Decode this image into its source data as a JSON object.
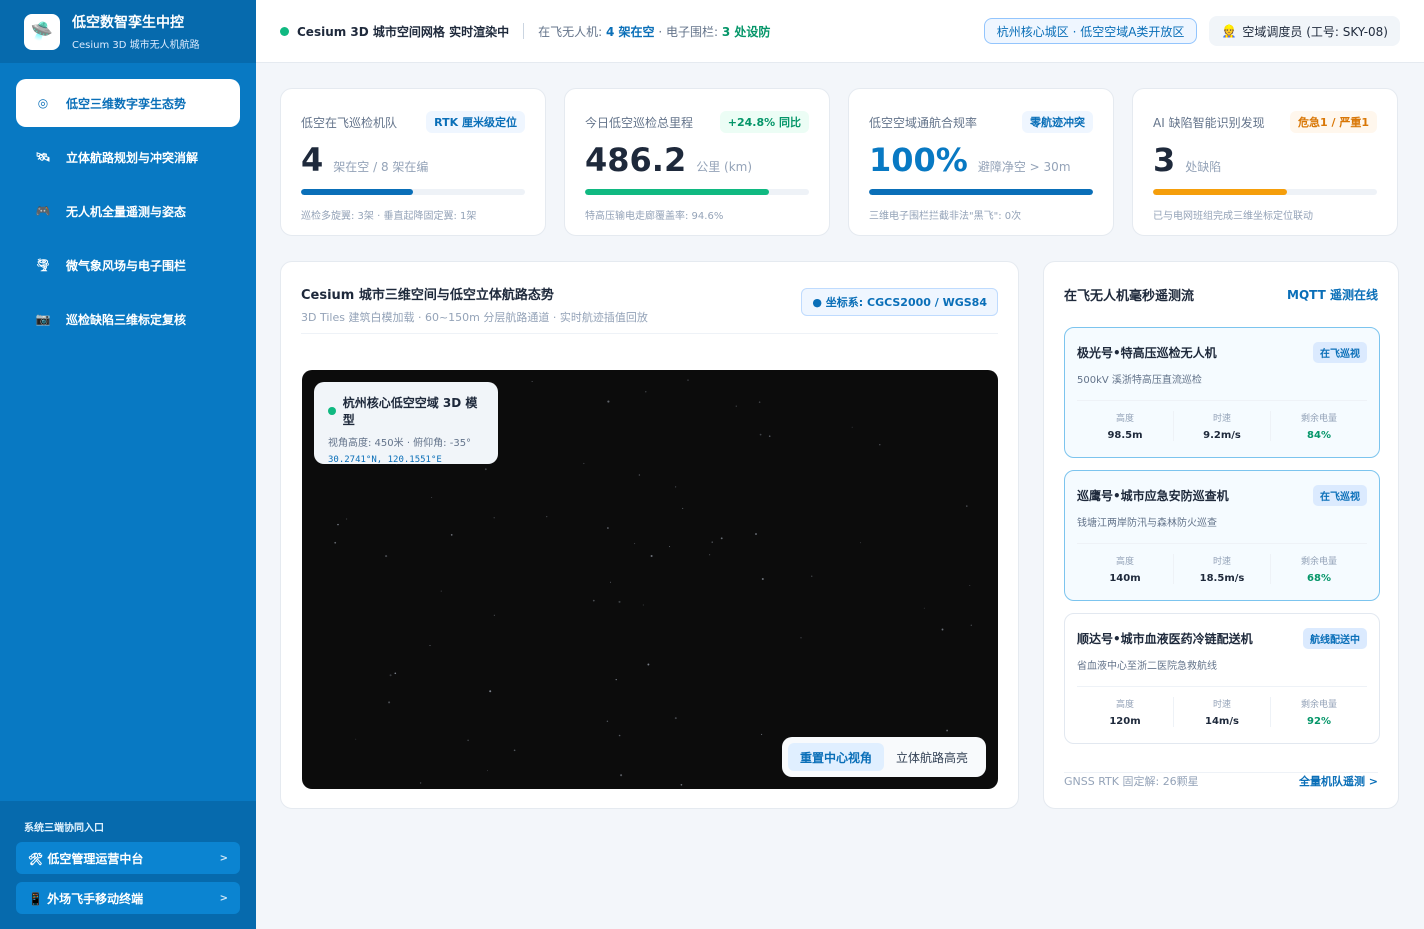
{
  "brand": {
    "title": "低空数智孪生中控",
    "subtitle": "Cesium 3D 城市无人机航路",
    "logo_icon": "ufo-icon"
  },
  "nav": [
    {
      "label": "低空三维数字孪生态势",
      "icon": "globe-icon",
      "glyph": "◎",
      "active": true
    },
    {
      "label": "立体航路规划与冲突消解",
      "icon": "satellite-icon",
      "glyph": "🛰",
      "active": false
    },
    {
      "label": "无人机全量遥测与姿态",
      "icon": "gamepad-icon",
      "glyph": "🎮",
      "active": false
    },
    {
      "label": "微气象风场与电子围栏",
      "icon": "tornado-icon",
      "glyph": "🌪",
      "active": false
    },
    {
      "label": "巡检缺陷三维标定复核",
      "icon": "camera-icon",
      "glyph": "📷",
      "active": false
    }
  ],
  "sidebar_footer": {
    "label": "系统三端协同入口",
    "buttons": [
      {
        "label": "🛠 低空管理运营中台",
        "arrow": ">"
      },
      {
        "label": "📱 外场飞手移动终端",
        "arrow": ">"
      }
    ]
  },
  "topbar": {
    "status_main": "Cesium 3D 城市空间网格 实时渲染中",
    "status_prefix": "在飞无人机:",
    "status_drones": "4 架在空",
    "status_mid": "· 电子围栏:",
    "status_fences": "3 处设防",
    "zone": "杭州核心城区 · 低空空域A类开放区",
    "user": "空域调度员 (工号: SKY-08)",
    "user_icon": "👷"
  },
  "stats": [
    {
      "label": "低空在飞巡检机队",
      "badge": "RTK 厘米级定位",
      "badge_style": "blue",
      "value": "4",
      "unit": "架在空  / 8 架在编",
      "progress": 0.5,
      "bar_color": "#0a6fb8",
      "note": "巡检多旋翼: 3架 · 垂直起降固定翼: 1架",
      "value_style": ""
    },
    {
      "label": "今日低空巡检总里程",
      "badge": "+24.8% 同比",
      "badge_style": "green",
      "value": "486.2",
      "unit": "公里 (km)",
      "progress": 0.82,
      "bar_color": "#10b981",
      "note": "特高压输电走廊覆盖率: 94.6%",
      "value_style": ""
    },
    {
      "label": "低空空域通航合规率",
      "badge": "零航迹冲突",
      "badge_style": "blue",
      "value": "100%",
      "unit": "避障净空 > 30m",
      "progress": 1.0,
      "bar_color": "#0a6fb8",
      "note": "三维电子围栏拦截非法\"黑飞\": 0次",
      "value_style": "blue"
    },
    {
      "label": "AI 缺陷智能识别发现",
      "badge": "危急1 / 严重1",
      "badge_style": "orange",
      "value": "3",
      "unit": "处缺陷",
      "progress": 0.6,
      "bar_color": "#f59e0b",
      "note": "已与电网班组完成三维坐标定位联动",
      "value_style": ""
    }
  ],
  "map": {
    "title": "Cesium 城市三维空间与低空立体航路态势",
    "subtitle": "3D Tiles 建筑白模加载 · 60~150m 分层航路通道 · 实时航迹插值回放",
    "coord_system": "● 坐标系: CGCS2000 / WGS84",
    "overlay_title": "杭州核心低空空域 3D 模型",
    "overlay_view": "视角高度: 450米 · 俯仰角: -35°",
    "overlay_coord": "30.2741°N, 120.1551°E",
    "btn_reset": "重置中心视角",
    "btn_highlight": "立体航路高亮"
  },
  "telemetry": {
    "title": "在飞无人机毫秒遥测流",
    "link": "MQTT 遥测在线",
    "labels": {
      "alt": "高度",
      "speed": "时速",
      "battery": "剩余电量"
    },
    "drones": [
      {
        "name": "极光号•特高压巡检无人机",
        "tag": "在飞巡视",
        "desc": "500kV 溪浙特高压直流巡检",
        "alt": "98.5m",
        "speed": "9.2m/s",
        "battery": "84%",
        "active": true
      },
      {
        "name": "巡鹰号•城市应急安防巡查机",
        "tag": "在飞巡视",
        "desc": "钱塘江两岸防汛与森林防火巡查",
        "alt": "140m",
        "speed": "18.5m/s",
        "battery": "68%",
        "active": true
      },
      {
        "name": "顺达号•城市血液医药冷链配送机",
        "tag": "航线配送中",
        "desc": "省血液中心至浙二医院急救航线",
        "alt": "120m",
        "speed": "14m/s",
        "battery": "92%",
        "active": false
      }
    ],
    "gnss": "GNSS RTK 固定解: 26颗星",
    "footer_link": "全量机队遥测 >"
  }
}
